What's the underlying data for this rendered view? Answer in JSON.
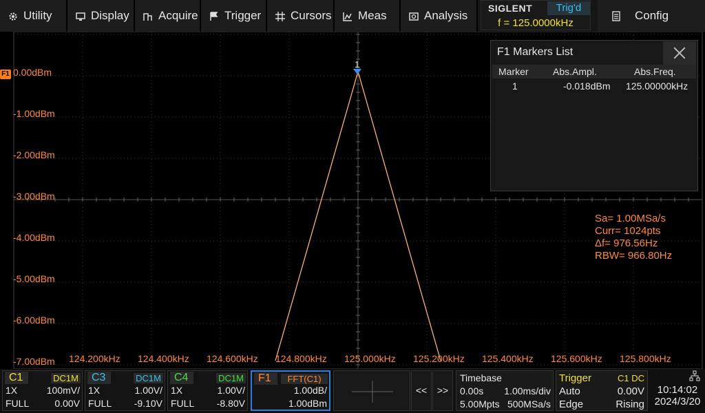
{
  "menu": {
    "utility": "Utility",
    "display": "Display",
    "acquire": "Acquire",
    "trigger": "Trigger",
    "cursors": "Cursors",
    "meas": "Meas",
    "analysis": "Analysis",
    "config": "Config"
  },
  "brand": {
    "logo": "SIGLENT",
    "trig_status": "Trig'd",
    "frequency": "f = 125.0000kHz"
  },
  "plot": {
    "f1_tag": "F1",
    "y_labels": [
      "0.00dBm",
      "-1.00dBm",
      "-2.00dBm",
      "-3.00dBm",
      "-4.00dBm",
      "-5.00dBm",
      "-6.00dBm",
      "-7.00dBm"
    ],
    "x_labels": [
      "124.200kHz",
      "124.400kHz",
      "124.600kHz",
      "124.800kHz",
      "125.000kHz",
      "125.200kHz",
      "125.400kHz",
      "125.600kHz",
      "125.800kHz"
    ],
    "marker_number": "1",
    "trace_color": "#ffb070"
  },
  "chart_data": {
    "type": "line",
    "x": [
      124.76,
      125.0,
      125.24
    ],
    "series": [
      {
        "values": [
          -7.0,
          0.0,
          -7.0
        ]
      }
    ],
    "xlim": [
      124.0,
      126.0
    ],
    "ylim": [
      -7.0,
      0.0
    ],
    "grid": true
  },
  "markers_list": {
    "title": "F1 Markers List",
    "headers": [
      "Marker",
      "Abs.Ampl.",
      "Abs.Freq."
    ],
    "rows": [
      {
        "marker": "1",
        "ampl": "-0.018dBm",
        "freq": "125.00000kHz"
      }
    ]
  },
  "fft_info": {
    "sa": "Sa=  1.00MSa/s",
    "curr": "Curr= 1024pts",
    "df": "Δf=  976.56Hz",
    "rbw": "RBW=  966.80Hz"
  },
  "channels": {
    "c1": {
      "name": "C1",
      "coupling": "DC1M",
      "probe": "1X",
      "scale": "100mV/",
      "bw": "FULL",
      "offset": "0.00V",
      "color": "#f0e030"
    },
    "c3": {
      "name": "C3",
      "coupling": "DC1M",
      "probe": "1X",
      "scale": "1.00V/",
      "bw": "FULL",
      "offset": "-9.10V",
      "color": "#38c0f0"
    },
    "c4": {
      "name": "C4",
      "coupling": "DC1M",
      "probe": "1X",
      "scale": "1.00V/",
      "bw": "FULL",
      "offset": "-8.80V",
      "color": "#40e040"
    },
    "f1": {
      "name": "F1",
      "source": "FFT(C1)",
      "scale": "1.00dB/",
      "ref": "1.00dBm",
      "color": "#ff8a3a"
    }
  },
  "nav": {
    "prev": "<<",
    "next": ">>"
  },
  "timebase": {
    "title": "Timebase",
    "delay": "0.00s",
    "scale": "1.00ms/div",
    "mem": "5.00Mpts",
    "rate": "500MSa/s"
  },
  "trigger_info": {
    "title": "Trigger",
    "source": "C1 DC",
    "mode": "Auto",
    "level": "0.00V",
    "type": "Edge",
    "slope": "Rising"
  },
  "clock": {
    "time": "10:14:02",
    "date": "2024/3/20"
  }
}
